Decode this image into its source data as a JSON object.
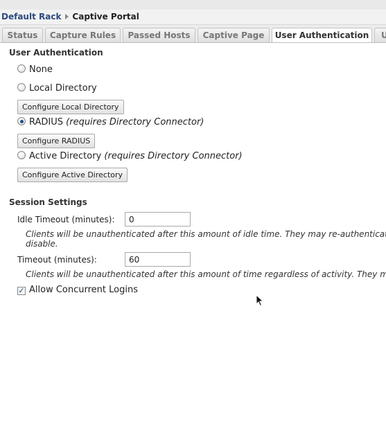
{
  "breadcrumb": {
    "root": "Default Rack",
    "current": "Captive Portal"
  },
  "tabs": [
    {
      "label": "Status",
      "active": false
    },
    {
      "label": "Capture Rules",
      "active": false
    },
    {
      "label": "Passed Hosts",
      "active": false
    },
    {
      "label": "Captive Page",
      "active": false
    },
    {
      "label": "User Authentication",
      "active": true
    },
    {
      "label": "U",
      "active": false
    }
  ],
  "user_auth": {
    "title": "User Authentication",
    "options": [
      {
        "label": "None",
        "note": "",
        "selected": false
      },
      {
        "label": "Local Directory",
        "note": "",
        "selected": false
      },
      {
        "label": "RADIUS",
        "note": "(requires Directory Connector)",
        "selected": true
      },
      {
        "label": "Active Directory",
        "note": "(requires Directory Connector)",
        "selected": false
      }
    ],
    "buttons": {
      "local": "Configure Local Directory",
      "radius": "Configure RADIUS",
      "active_directory": "Configure Active Directory"
    }
  },
  "session": {
    "title": "Session Settings",
    "idle_timeout": {
      "label": "Idle Timeout (minutes):",
      "value": "0",
      "help_line1": "Clients will be unauthenticated after this amount of idle time. They may re-authenticate.",
      "help_line2": "disable."
    },
    "timeout": {
      "label": "Timeout (minutes):",
      "value": "60",
      "help_line1": "Clients will be unauthenticated after this amount of time regardless of activity. They may re-authenticate."
    },
    "concurrent": {
      "label": "Allow Concurrent Logins",
      "checked": true
    }
  },
  "icons": {
    "breadcrumb_separator": "triangle-right-icon",
    "cursor": "mouse-pointer-icon",
    "check": "checkmark-icon"
  },
  "colors": {
    "breadcrumb_link": "#2a4a7a",
    "radio_selected": "#1c4f8c",
    "tab_bar": "#ececec"
  }
}
